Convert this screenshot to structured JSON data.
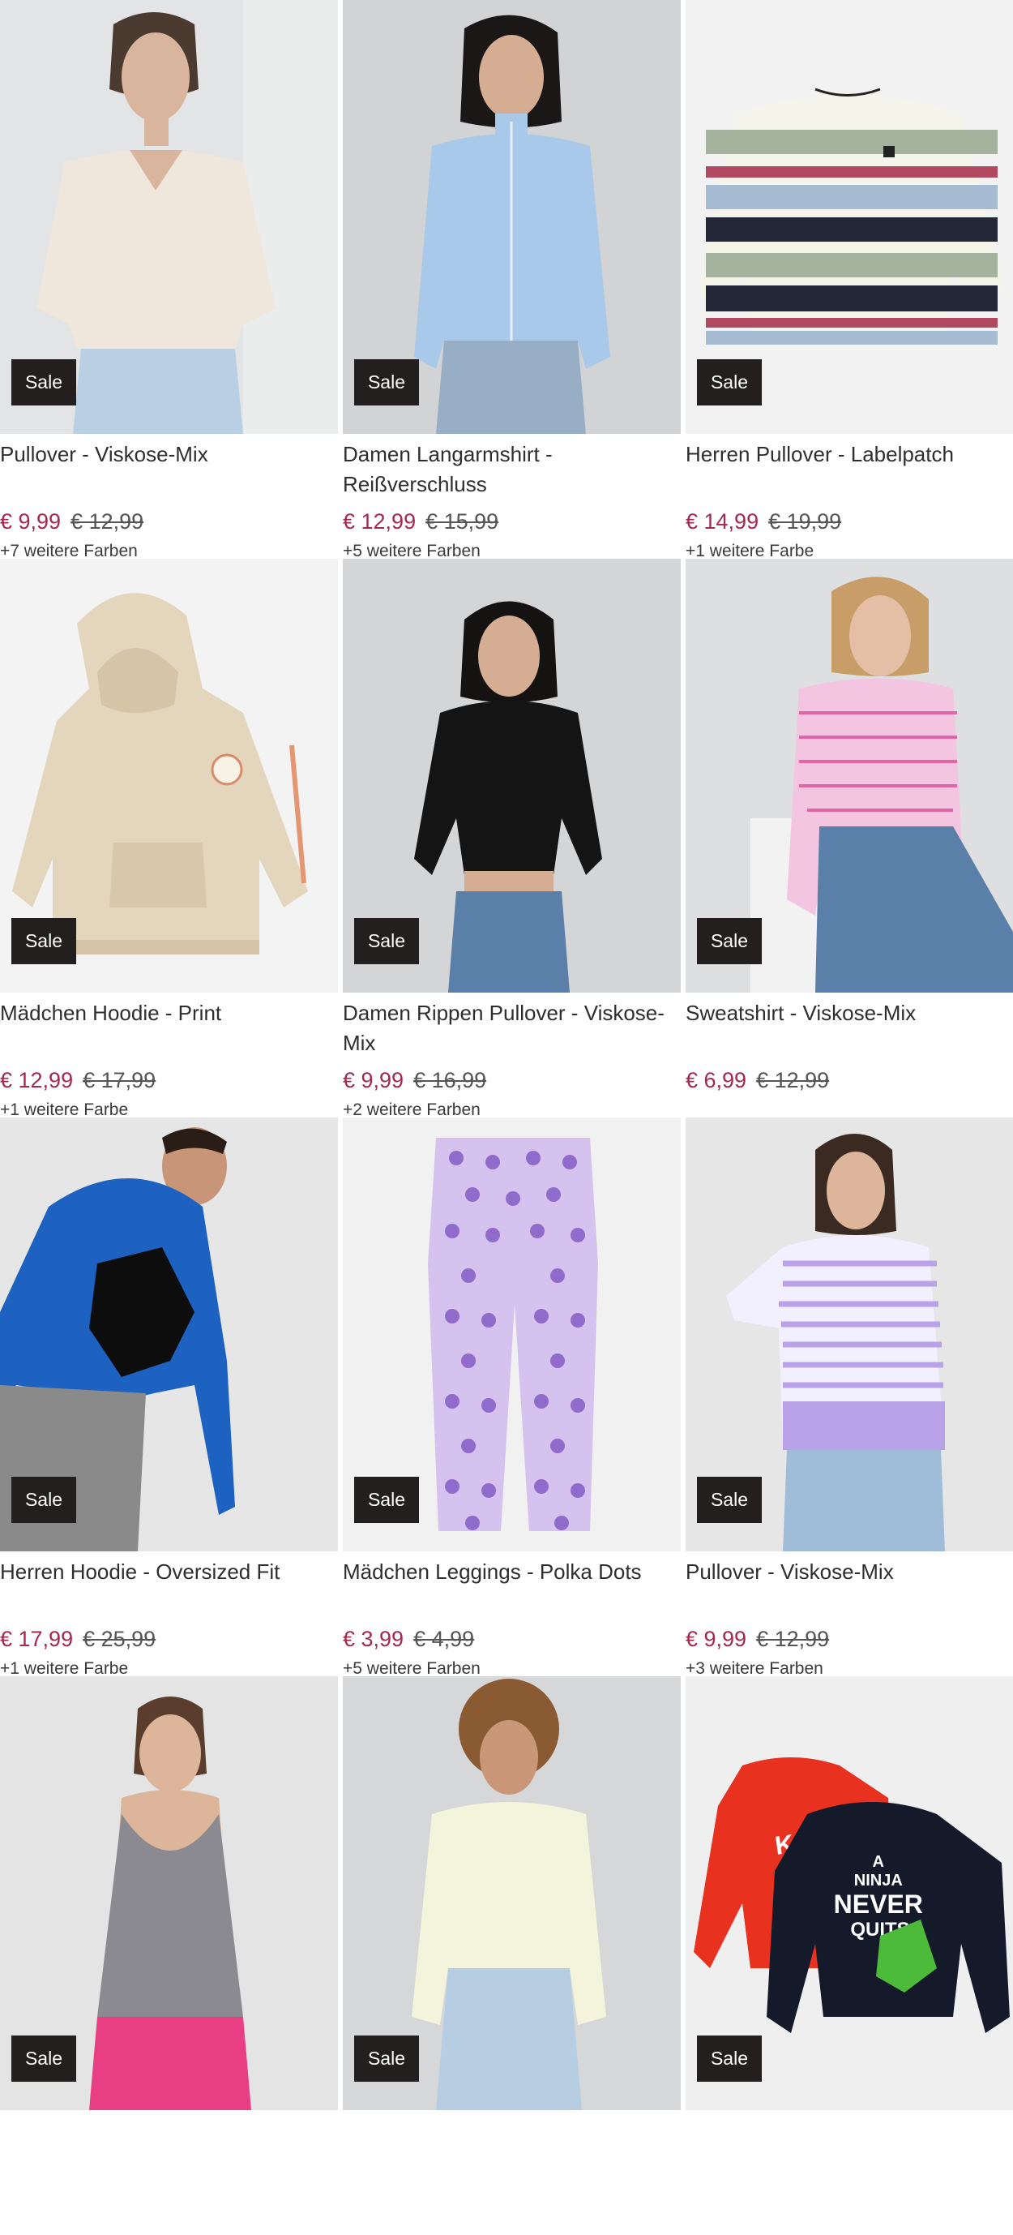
{
  "badge_label": "Sale",
  "products": [
    {
      "title": "Pullover - Viskose-Mix",
      "price": "€ 9,99",
      "old_price": "€ 12,99",
      "colors": "+7 weitere Farben",
      "image": "woman-cream-vneck-pullover",
      "accent": "#efe6dc"
    },
    {
      "title": "Damen Langarmshirt - Reißverschluss",
      "price": "€ 12,99",
      "old_price": "€ 15,99",
      "colors": "+5 weitere Farben",
      "image": "woman-blue-zip-longsleeve",
      "accent": "#a9c9ea"
    },
    {
      "title": "Herren Pullover - Labelpatch",
      "price": "€ 14,99",
      "old_price": "€ 19,99",
      "colors": "+1 weitere Farbe",
      "image": "striped-pullover-product",
      "accent": "#a6bcd3"
    },
    {
      "title": "Mädchen Hoodie - Print",
      "price": "€ 12,99",
      "old_price": "€ 17,99",
      "colors": "+1 weitere Farbe",
      "image": "beige-hoodie-product",
      "accent": "#e4d6bd"
    },
    {
      "title": "Damen Rippen Pullover - Viskose-Mix",
      "price": "€ 9,99",
      "old_price": "€ 16,99",
      "colors": "+2 weitere Farben",
      "image": "woman-black-rib-pullover",
      "accent": "#141414"
    },
    {
      "title": "Sweatshirt - Viskose-Mix",
      "price": "€ 6,99",
      "old_price": "€ 12,99",
      "colors": "",
      "image": "woman-pink-striped-sweatshirt",
      "accent": "#f3c5e0"
    },
    {
      "title": "Herren Hoodie - Oversized Fit",
      "price": "€ 17,99",
      "old_price": "€ 25,99",
      "colors": "+1 weitere Farbe",
      "image": "man-blue-hoodie",
      "accent": "#1d62c0"
    },
    {
      "title": "Mädchen Leggings - Polka Dots",
      "price": "€ 3,99",
      "old_price": "€ 4,99",
      "colors": "+5 weitere Farben",
      "image": "lilac-polka-dot-leggings",
      "accent": "#d6c2ef"
    },
    {
      "title": "Pullover - Viskose-Mix",
      "price": "€ 9,99",
      "old_price": "€ 12,99",
      "colors": "+3 weitere Farben",
      "image": "woman-lilac-striped-pullover",
      "accent": "#b9a2e8"
    },
    {
      "title": "",
      "price": "",
      "old_price": "",
      "colors": "",
      "image": "woman-grey-tank-top",
      "accent": "#8a8a90"
    },
    {
      "title": "",
      "price": "",
      "old_price": "",
      "colors": "",
      "image": "woman-light-yellow-sweater",
      "accent": "#f4f4dc"
    },
    {
      "title": "",
      "price": "",
      "old_price": "",
      "colors": "",
      "image": "ninjago-longsleeve-shirts",
      "accent": "#e8321f",
      "print_text": [
        "A",
        "NINJA",
        "NEVER",
        "QUITS",
        "KAI"
      ]
    }
  ]
}
